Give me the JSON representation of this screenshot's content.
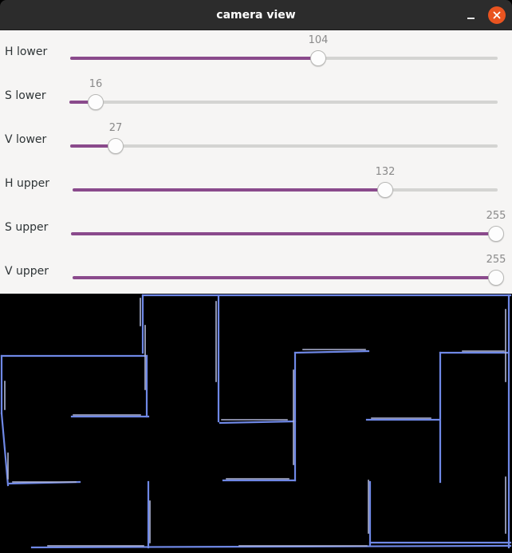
{
  "window": {
    "title": "camera view",
    "controls": [
      "minimize-icon",
      "close-icon"
    ],
    "accent": "#e95420"
  },
  "sliders": [
    {
      "label": "H lower",
      "value": "104",
      "max": 255
    },
    {
      "label": "S lower",
      "value": "16",
      "max": 255
    },
    {
      "label": "V lower",
      "value": "27",
      "max": 255
    },
    {
      "label": "H upper",
      "value": "132",
      "max": 180
    },
    {
      "label": "S upper",
      "value": "255",
      "max": 255
    },
    {
      "label": "V upper",
      "value": "255",
      "max": 255
    }
  ],
  "colors": {
    "slider_fill": "#8a4a8c",
    "slider_track": "#d4d4d2",
    "maze_line": "#6f88e6",
    "maze_line_light": "#b0b6d8"
  }
}
